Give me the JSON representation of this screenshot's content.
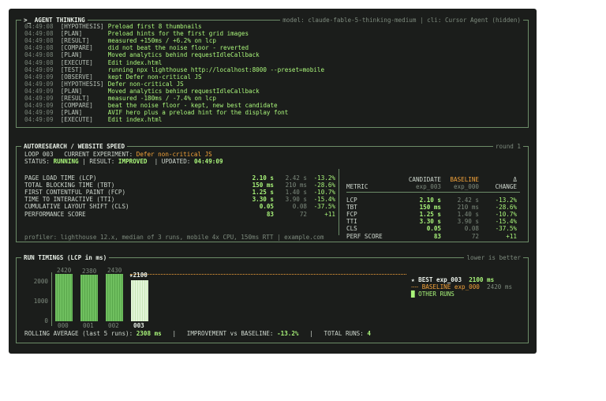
{
  "thinking": {
    "title": ">_ AGENT THINKING",
    "right": "model: claude-fable-5-thinking-medium | cli: Cursor Agent (hidden)",
    "lines": [
      {
        "t": "04:49:08",
        "tag": "[HYPOTHESIS]",
        "msg": "Preload first 8 thumbnails"
      },
      {
        "t": "04:49:08",
        "tag": "[PLAN]",
        "msg": "Preload hints for the first grid images"
      },
      {
        "t": "04:49:08",
        "tag": "[RESULT]",
        "msg": "measured +150ms / +6.2% on lcp"
      },
      {
        "t": "04:49:08",
        "tag": "[COMPARE]",
        "msg": "did not beat the noise floor - reverted"
      },
      {
        "t": "04:49:08",
        "tag": "[PLAN]",
        "msg": "Moved analytics behind requestIdleCallback"
      },
      {
        "t": "04:49:08",
        "tag": "[EXECUTE]",
        "msg": "Edit index.html"
      },
      {
        "t": "04:49:09",
        "tag": "[TEST]",
        "msg": "running npx lighthouse http://localhost:8000 --preset=mobile"
      },
      {
        "t": "04:49:09",
        "tag": "[OBSERVE]",
        "msg": "kept Defer non-critical JS"
      },
      {
        "t": "04:49:09",
        "tag": "[HYPOTHESIS]",
        "msg": "Defer non-critical JS"
      },
      {
        "t": "04:49:09",
        "tag": "[PLAN]",
        "msg": "Moved analytics behind requestIdleCallback"
      },
      {
        "t": "04:49:09",
        "tag": "[RESULT]",
        "msg": "measured -180ms / -7.4% on lcp"
      },
      {
        "t": "04:49:09",
        "tag": "[COMPARE]",
        "msg": "beat the noise floor - kept, new best candidate"
      },
      {
        "t": "04:49:09",
        "tag": "[PLAN]",
        "msg": "AVIF hero plus a preload hint for the display font"
      },
      {
        "t": "04:49:09",
        "tag": "[EXECUTE]",
        "msg": "Edit index.html"
      }
    ]
  },
  "speed": {
    "title": "AUTORESEARCH / WEBSITE SPEED",
    "round": "round 1",
    "loop_label": "LOOP 003",
    "experiment_label": "CURRENT EXPERIMENT:",
    "experiment": "Defer non-critical JS",
    "status_label": "STATUS:",
    "status": "RUNNING",
    "result_label": "| RESULT:",
    "result": "IMPROVED",
    "updated_label": "| UPDATED:",
    "updated": "04:49:09",
    "metrics": [
      {
        "name": "PAGE LOAD TIME (LCP)",
        "cand": "2.10 s",
        "base": "2.42 s",
        "delta": "-13.2%"
      },
      {
        "name": "TOTAL BLOCKING TIME (TBT)",
        "cand": "150 ms",
        "base": "210 ms",
        "delta": "-28.6%"
      },
      {
        "name": "FIRST CONTENTFUL PAINT (FCP)",
        "cand": "1.25 s",
        "base": "1.40 s",
        "delta": "-10.7%"
      },
      {
        "name": "TIME TO INTERACTIVE (TTI)",
        "cand": "3.30 s",
        "base": "3.90 s",
        "delta": "-15.4%"
      },
      {
        "name": "CUMULATIVE LAYOUT SHIFT (CLS)",
        "cand": "0.05",
        "base": "0.08",
        "delta": "-37.5%"
      },
      {
        "name": "PERFORMANCE SCORE",
        "cand": "83",
        "base": "72",
        "delta": "+11"
      }
    ],
    "table": {
      "h_metric": "METRIC",
      "h_cand": "CANDIDATE",
      "h_cand_sub": "exp_003",
      "h_base": "BASELINE",
      "h_base_sub": "exp_000",
      "h_delta": "Δ",
      "h_delta_sub": "CHANGE",
      "rows": [
        {
          "name": "LCP",
          "cand": "2.10 s",
          "base": "2.42 s",
          "delta": "-13.2%"
        },
        {
          "name": "TBT",
          "cand": "150 ms",
          "base": "210 ms",
          "delta": "-28.6%"
        },
        {
          "name": "FCP",
          "cand": "1.25 s",
          "base": "1.40 s",
          "delta": "-10.7%"
        },
        {
          "name": "TTI",
          "cand": "3.30 s",
          "base": "3.90 s",
          "delta": "-15.4%"
        },
        {
          "name": "CLS",
          "cand": "0.05",
          "base": "0.08",
          "delta": "-37.5%"
        },
        {
          "name": "PERF SCORE",
          "cand": "83",
          "base": "72",
          "delta": "+11"
        }
      ]
    },
    "profiler": "profiler: lighthouse 12.x, median of 3 runs, mobile 4x CPU, 150ms RTT | example.com"
  },
  "timings": {
    "title": "RUN TIMINGS (LCP in ms)",
    "right": "lower is better",
    "legend_best_prefix": "★ BEST",
    "legend_best_name": "exp_003",
    "legend_best_value": "2100 ms",
    "legend_base_prefix": "┄┄ BASELINE",
    "legend_base_name": "exp_000",
    "legend_base_value": "2420 ms",
    "legend_other": "█ OTHER RUNS",
    "best_label": "★2100",
    "rolling_label": "ROLLING AVERAGE (last 5 runs):",
    "rolling_value": "2308 ms",
    "improvement_label": "IMPROVEMENT vs BASELINE:",
    "improvement_value": "-13.2%",
    "total_label": "TOTAL RUNS:",
    "total_value": "4"
  },
  "chart_data": {
    "type": "bar",
    "title": "RUN TIMINGS (LCP in ms)",
    "categories": [
      "000",
      "001",
      "002",
      "003"
    ],
    "values": [
      2420,
      2380,
      2430,
      2100
    ],
    "ylim": [
      0,
      2500
    ],
    "yticks": [
      0,
      1000,
      2000,
      2500
    ],
    "baseline": 2420,
    "best_index": 3
  },
  "colors": {
    "accent": "#a9f57a",
    "warn": "#f4a33a",
    "border": "#6c8c68",
    "bg": "#1b1d1b"
  }
}
